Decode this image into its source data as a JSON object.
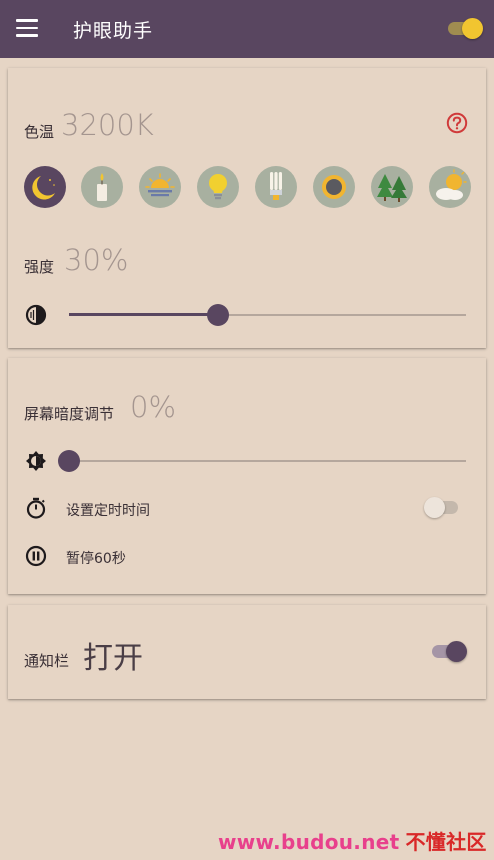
{
  "header": {
    "menu_icon": "hamburger-menu-icon",
    "title": "护眼助手",
    "master_toggle_on": true
  },
  "color_temp": {
    "label": "色温",
    "value": "3200K",
    "help_icon": "help-circle-icon",
    "help_color": "#d03a3a",
    "presets": [
      {
        "icon": "moon-icon",
        "active": true
      },
      {
        "icon": "candle-icon",
        "active": false
      },
      {
        "icon": "sunset-icon",
        "active": false
      },
      {
        "icon": "light-bulb-icon",
        "active": false
      },
      {
        "icon": "fluorescent-bulb-icon",
        "active": false
      },
      {
        "icon": "sun-eclipse-icon",
        "active": false
      },
      {
        "icon": "forest-icon",
        "active": false
      },
      {
        "icon": "sun-cloud-icon",
        "active": false
      }
    ]
  },
  "intensity": {
    "label": "强度",
    "value": "30%",
    "icon": "contrast-icon",
    "slider_fraction": 0.375
  },
  "dim": {
    "label": "屏幕暗度调节",
    "value": "0%",
    "icon": "brightness-icon",
    "slider_fraction": 0.0
  },
  "timer": {
    "icon": "stopwatch-icon",
    "label": "设置定时时间",
    "enabled": false
  },
  "pause": {
    "icon": "pause-circle-icon",
    "label": "暂停60秒"
  },
  "notification": {
    "label": "通知栏",
    "value": "打开",
    "enabled": true
  },
  "watermark": {
    "url": "www.budou.net",
    "site": "不懂社区"
  },
  "colors": {
    "accent": "#594660",
    "background": "#e6d5c5",
    "toggle_on": "#f1c530"
  }
}
